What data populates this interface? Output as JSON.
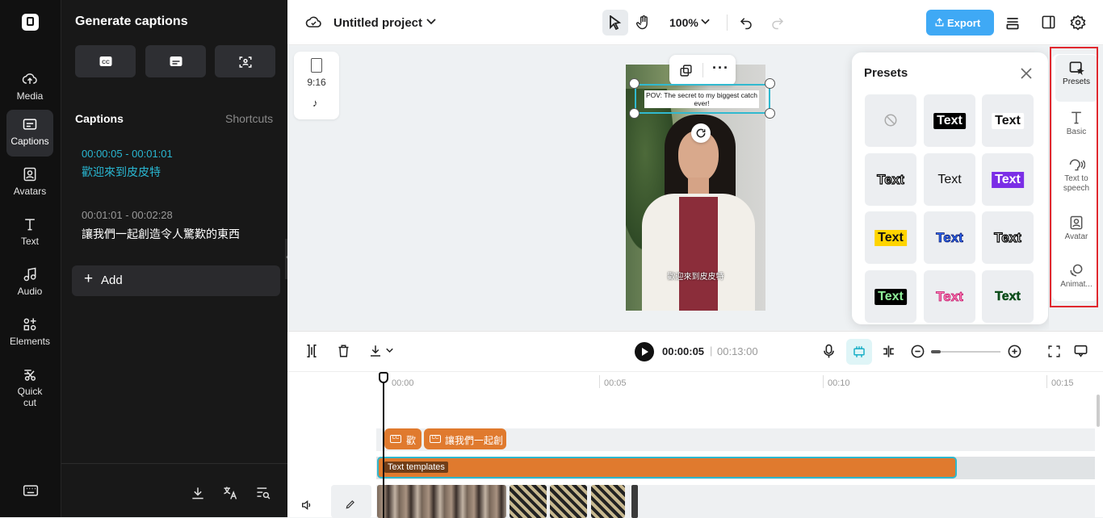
{
  "rail": {
    "items": [
      {
        "label": "Media",
        "icon": "cloud-upload-icon"
      },
      {
        "label": "Captions",
        "icon": "captions-icon",
        "active": true
      },
      {
        "label": "Avatars",
        "icon": "avatar-icon"
      },
      {
        "label": "Text",
        "icon": "text-icon"
      },
      {
        "label": "Audio",
        "icon": "music-note-icon"
      },
      {
        "label": "Elements",
        "icon": "elements-icon"
      },
      {
        "label": "Quick\ncut",
        "icon": "scissors-icon"
      }
    ]
  },
  "panel": {
    "title": "Generate captions",
    "captions_label": "Captions",
    "shortcuts_label": "Shortcuts",
    "captions": [
      {
        "time": "00:00:05 - 00:01:01",
        "text": "歡迎來到皮皮特"
      },
      {
        "time": "00:01:01 - 00:02:28",
        "text": "讓我們一起創造令人驚歎的東西"
      }
    ],
    "add_label": "Add"
  },
  "topbar": {
    "project_title": "Untitled project",
    "zoom": "100%",
    "export_label": "Export"
  },
  "canvas": {
    "ratio": "9:16",
    "video_top_text": "POV: The secret to my biggest catch ever!",
    "video_subtitle": "歡迎來到皮皮特"
  },
  "presets": {
    "title": "Presets",
    "tiles": [
      {
        "text": "",
        "style": "none"
      },
      {
        "text": "Text",
        "style": "black-box"
      },
      {
        "text": "Text",
        "style": "white-box"
      },
      {
        "text": "Text",
        "style": "white-outline-black"
      },
      {
        "text": "Text",
        "style": "plain"
      },
      {
        "text": "Text",
        "style": "purple-box"
      },
      {
        "text": "Text",
        "style": "yellow-box"
      },
      {
        "text": "Text",
        "style": "blue-outline"
      },
      {
        "text": "Text",
        "style": "black-outline-white"
      },
      {
        "text": "Text",
        "style": "green-on-black"
      },
      {
        "text": "Text",
        "style": "pink-outline"
      },
      {
        "text": "Text",
        "style": "dark-green-outline"
      }
    ]
  },
  "right_tabs": [
    {
      "label": "Presets",
      "icon": "presets-icon"
    },
    {
      "label": "Basic",
      "icon": "text-icon"
    },
    {
      "label": "Text to speech",
      "icon": "speech-icon"
    },
    {
      "label": "Avatar",
      "icon": "avatar-icon"
    },
    {
      "label": "Animat...",
      "icon": "animation-icon"
    }
  ],
  "timeline": {
    "current_time": "00:00:05",
    "total_time": "00:13:00",
    "ruler": [
      "00:00",
      "00:05",
      "00:10",
      "00:15"
    ],
    "caption_clips": [
      "歡",
      "讓我們一起創"
    ],
    "text_clip": "Text templates"
  }
}
